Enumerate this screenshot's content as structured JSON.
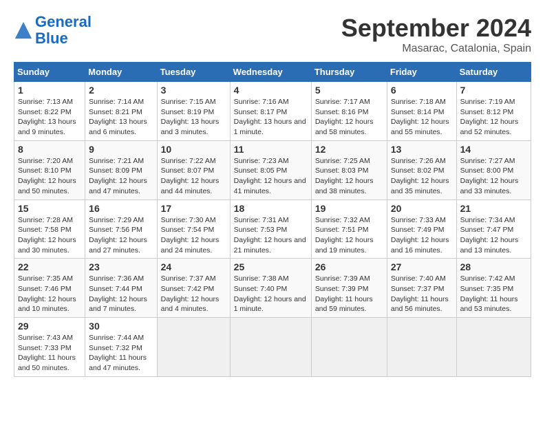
{
  "header": {
    "logo_line1": "General",
    "logo_line2": "Blue",
    "month": "September 2024",
    "location": "Masarac, Catalonia, Spain"
  },
  "weekdays": [
    "Sunday",
    "Monday",
    "Tuesday",
    "Wednesday",
    "Thursday",
    "Friday",
    "Saturday"
  ],
  "weeks": [
    [
      {
        "day": "1",
        "sunrise": "7:13 AM",
        "sunset": "8:22 PM",
        "daylight": "13 hours and 9 minutes."
      },
      {
        "day": "2",
        "sunrise": "7:14 AM",
        "sunset": "8:21 PM",
        "daylight": "13 hours and 6 minutes."
      },
      {
        "day": "3",
        "sunrise": "7:15 AM",
        "sunset": "8:19 PM",
        "daylight": "13 hours and 3 minutes."
      },
      {
        "day": "4",
        "sunrise": "7:16 AM",
        "sunset": "8:17 PM",
        "daylight": "13 hours and 1 minute."
      },
      {
        "day": "5",
        "sunrise": "7:17 AM",
        "sunset": "8:16 PM",
        "daylight": "12 hours and 58 minutes."
      },
      {
        "day": "6",
        "sunrise": "7:18 AM",
        "sunset": "8:14 PM",
        "daylight": "12 hours and 55 minutes."
      },
      {
        "day": "7",
        "sunrise": "7:19 AM",
        "sunset": "8:12 PM",
        "daylight": "12 hours and 52 minutes."
      }
    ],
    [
      {
        "day": "8",
        "sunrise": "7:20 AM",
        "sunset": "8:10 PM",
        "daylight": "12 hours and 50 minutes."
      },
      {
        "day": "9",
        "sunrise": "7:21 AM",
        "sunset": "8:09 PM",
        "daylight": "12 hours and 47 minutes."
      },
      {
        "day": "10",
        "sunrise": "7:22 AM",
        "sunset": "8:07 PM",
        "daylight": "12 hours and 44 minutes."
      },
      {
        "day": "11",
        "sunrise": "7:23 AM",
        "sunset": "8:05 PM",
        "daylight": "12 hours and 41 minutes."
      },
      {
        "day": "12",
        "sunrise": "7:25 AM",
        "sunset": "8:03 PM",
        "daylight": "12 hours and 38 minutes."
      },
      {
        "day": "13",
        "sunrise": "7:26 AM",
        "sunset": "8:02 PM",
        "daylight": "12 hours and 35 minutes."
      },
      {
        "day": "14",
        "sunrise": "7:27 AM",
        "sunset": "8:00 PM",
        "daylight": "12 hours and 33 minutes."
      }
    ],
    [
      {
        "day": "15",
        "sunrise": "7:28 AM",
        "sunset": "7:58 PM",
        "daylight": "12 hours and 30 minutes."
      },
      {
        "day": "16",
        "sunrise": "7:29 AM",
        "sunset": "7:56 PM",
        "daylight": "12 hours and 27 minutes."
      },
      {
        "day": "17",
        "sunrise": "7:30 AM",
        "sunset": "7:54 PM",
        "daylight": "12 hours and 24 minutes."
      },
      {
        "day": "18",
        "sunrise": "7:31 AM",
        "sunset": "7:53 PM",
        "daylight": "12 hours and 21 minutes."
      },
      {
        "day": "19",
        "sunrise": "7:32 AM",
        "sunset": "7:51 PM",
        "daylight": "12 hours and 19 minutes."
      },
      {
        "day": "20",
        "sunrise": "7:33 AM",
        "sunset": "7:49 PM",
        "daylight": "12 hours and 16 minutes."
      },
      {
        "day": "21",
        "sunrise": "7:34 AM",
        "sunset": "7:47 PM",
        "daylight": "12 hours and 13 minutes."
      }
    ],
    [
      {
        "day": "22",
        "sunrise": "7:35 AM",
        "sunset": "7:46 PM",
        "daylight": "12 hours and 10 minutes."
      },
      {
        "day": "23",
        "sunrise": "7:36 AM",
        "sunset": "7:44 PM",
        "daylight": "12 hours and 7 minutes."
      },
      {
        "day": "24",
        "sunrise": "7:37 AM",
        "sunset": "7:42 PM",
        "daylight": "12 hours and 4 minutes."
      },
      {
        "day": "25",
        "sunrise": "7:38 AM",
        "sunset": "7:40 PM",
        "daylight": "12 hours and 1 minute."
      },
      {
        "day": "26",
        "sunrise": "7:39 AM",
        "sunset": "7:39 PM",
        "daylight": "11 hours and 59 minutes."
      },
      {
        "day": "27",
        "sunrise": "7:40 AM",
        "sunset": "7:37 PM",
        "daylight": "11 hours and 56 minutes."
      },
      {
        "day": "28",
        "sunrise": "7:42 AM",
        "sunset": "7:35 PM",
        "daylight": "11 hours and 53 minutes."
      }
    ],
    [
      {
        "day": "29",
        "sunrise": "7:43 AM",
        "sunset": "7:33 PM",
        "daylight": "11 hours and 50 minutes."
      },
      {
        "day": "30",
        "sunrise": "7:44 AM",
        "sunset": "7:32 PM",
        "daylight": "11 hours and 47 minutes."
      },
      null,
      null,
      null,
      null,
      null
    ]
  ]
}
